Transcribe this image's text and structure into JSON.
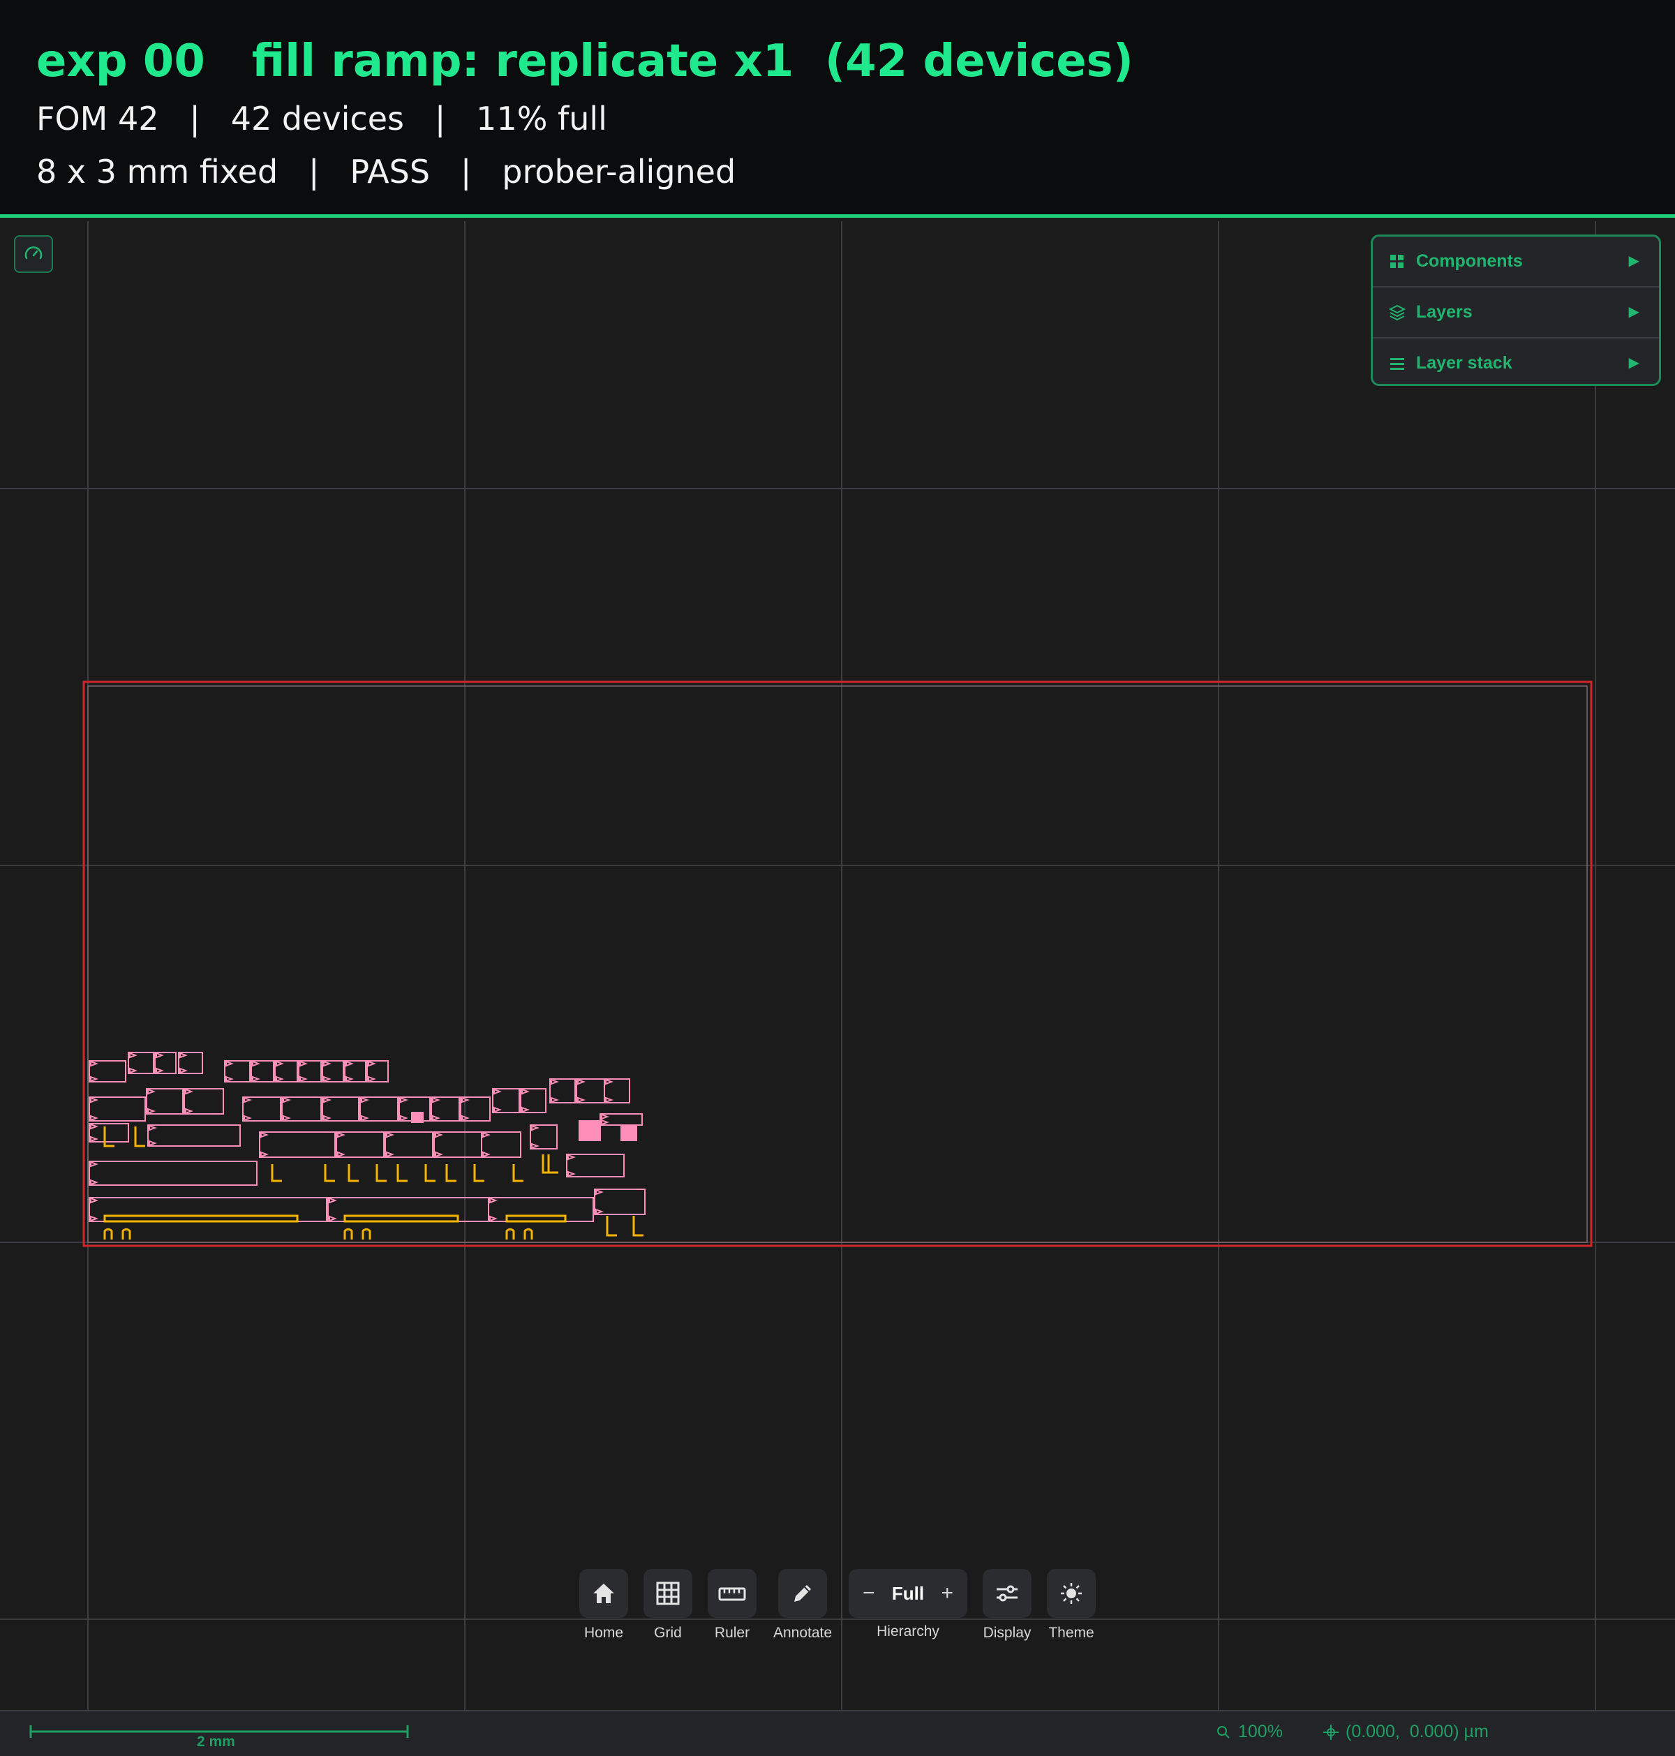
{
  "header": {
    "title": "exp 00   fill ramp: replicate x1  (42 devices)",
    "line1": "FOM 42   |   42 devices   |   11% full",
    "line2": "8 x 3 mm fixed   |   PASS   |   prober-aligned"
  },
  "panel": {
    "items": [
      {
        "label": "Components",
        "icon": "grid-icon"
      },
      {
        "label": "Layers",
        "icon": "layers-icon"
      },
      {
        "label": "Layer stack",
        "icon": "menu-lines-icon"
      }
    ]
  },
  "toolbar": {
    "home": "Home",
    "grid": "Grid",
    "ruler": "Ruler",
    "annotate": "Annotate",
    "hierarchy_value": "Full",
    "hierarchy_minus": "−",
    "hierarchy_plus": "+",
    "hierarchy": "Hierarchy",
    "display": "Display",
    "theme": "Theme"
  },
  "status": {
    "scale": "2 mm",
    "zoom": "100%",
    "coords": "(0.000,  0.000) µm"
  },
  "colors": {
    "accent": "#20e88c",
    "die_outline": "#d0262b",
    "waveguide": "#ff8fb8",
    "metal": "#f5b400",
    "grid": "#3b3d40"
  }
}
